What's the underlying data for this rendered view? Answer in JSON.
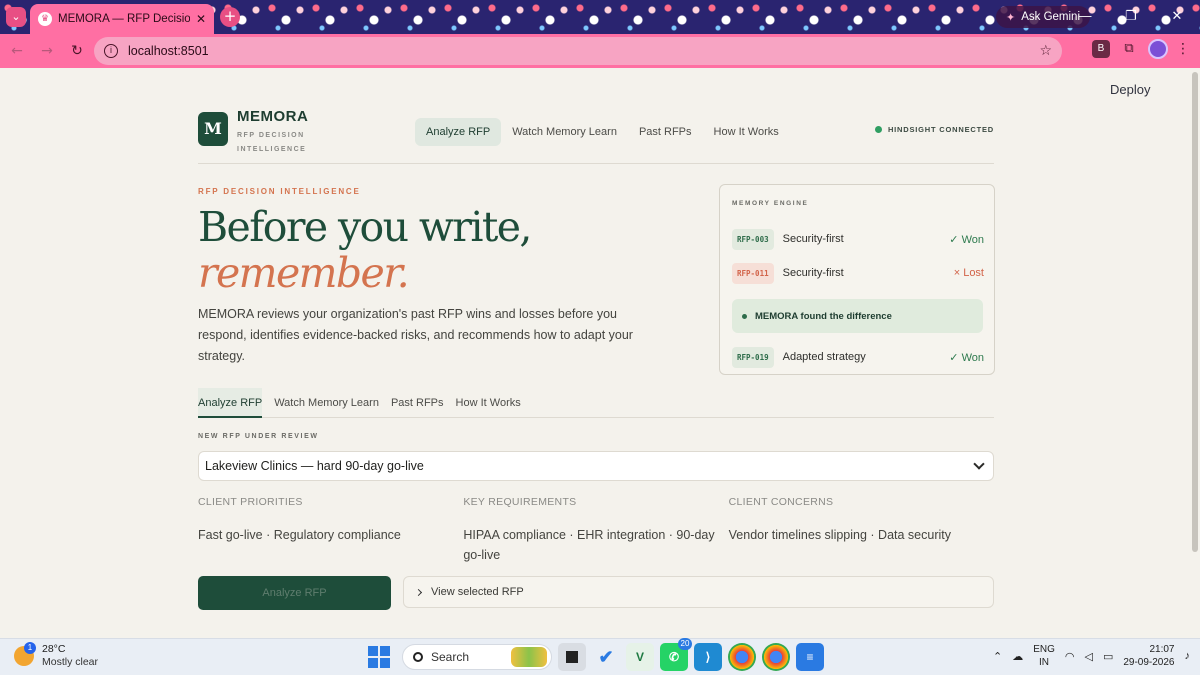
{
  "browser": {
    "tab_title": "MEMORA — RFP Decision Intelligence",
    "url": "localhost:8501",
    "ask_gemini": "Ask Gemini",
    "extension_letter": "B"
  },
  "app": {
    "deploy_label": "Deploy",
    "logo_letter": "M",
    "brand_name": "MEMORA",
    "brand_tagline": "RFP DECISION INTELLIGENCE",
    "nav": [
      "Analyze RFP",
      "Watch Memory Learn",
      "Past RFPs",
      "How It Works"
    ],
    "status": "HINDSIGHT CONNECTED",
    "eyebrow": "RFP DECISION INTELLIGENCE",
    "headline_line1": "Before you write,",
    "headline_line2": "remember.",
    "description": "MEMORA reviews your organization's past RFP wins and losses before you respond, identifies evidence-backed risks, and recommends how to adapt your strategy.",
    "memory_engine": {
      "title": "MEMORY ENGINE",
      "rows": [
        {
          "id": "RFP-003",
          "label": "Security-first",
          "result": "✓ Won",
          "status": "won"
        },
        {
          "id": "RFP-011",
          "label": "Security-first",
          "result": "× Lost",
          "status": "lost"
        },
        {
          "id": "RFP-019",
          "label": "Adapted strategy",
          "result": "✓ Won",
          "status": "won"
        }
      ],
      "found_text": "MEMORA found the difference"
    },
    "tabs": [
      "Analyze RFP",
      "Watch Memory Learn",
      "Past RFPs",
      "How It Works"
    ],
    "review_label": "NEW RFP UNDER REVIEW",
    "selected_rfp": "Lakeview Clinics — hard 90-day go-live",
    "columns": [
      {
        "heading": "CLIENT PRIORITIES",
        "value": "Fast go-live · Regulatory compliance"
      },
      {
        "heading": "KEY REQUIREMENTS",
        "value": "HIPAA compliance · EHR integration · 90-day go-live"
      },
      {
        "heading": "CLIENT CONCERNS",
        "value": "Vendor timelines slipping · Data security"
      }
    ],
    "analyze_button": "Analyze RFP",
    "view_selected": "View selected RFP"
  },
  "taskbar": {
    "weather_temp": "28°C",
    "weather_desc": "Mostly clear",
    "weather_badge": "1",
    "search_label": "Search",
    "whatsapp_count": "20",
    "lang_line1": "ENG",
    "lang_line2": "IN",
    "time": "21:07",
    "date": "29-09-2026"
  }
}
